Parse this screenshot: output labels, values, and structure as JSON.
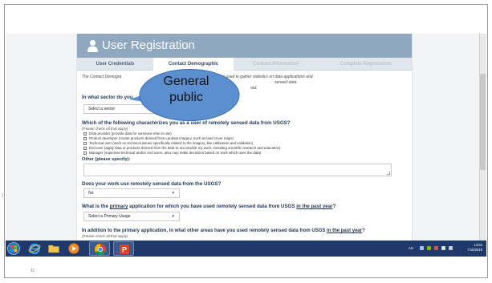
{
  "slide": {
    "number": "11",
    "left_mark": ")"
  },
  "app": {
    "title": "User Registration"
  },
  "tabs": [
    {
      "label": "User Credentials",
      "state": "normal"
    },
    {
      "label": "Contact Demographic",
      "state": "active"
    },
    {
      "label": "Contact Information",
      "state": "disabled"
    },
    {
      "label": "Complete Registration",
      "state": "disabled"
    }
  ],
  "intro": {
    "text": "The Contact Demographic ... data. This information is used to gather statistics on data applications and ... sensed data.",
    "line1_left": "The Contact Demogra",
    "line1_right": "data. This information is used to gather statistics on data applications and",
    "line2_right": "sensed data.",
    "line3_right": "red."
  },
  "callout": {
    "text": "General public"
  },
  "q_sector": {
    "label": "In what sector do you",
    "select_value": "Select a sector"
  },
  "q_characterize": {
    "label": "Which of the following characterizes you as a user of remotely sensed data from USGS?",
    "hint": "(Please check all that apply)",
    "options": [
      "Data provider (provide data for someone else to use)",
      "Product developer (create products derived from Landsat imagery, such as land cover maps)",
      "Technical user (work on technical issues specifically related to the imagery, like calibration and validation)",
      "End user (apply data or products derived from the data to accomplish my work, including scientific research and education)",
      "Manager (supervise technical and/or end users, also may make decisions based on work which uses the data)"
    ],
    "other_label": "Other (please specify):"
  },
  "q_remote": {
    "label": "Does your work use remotely sensed data from the USGS?",
    "select_value": "No"
  },
  "q_primary": {
    "label_pre": "What is the ",
    "label_u": "primary",
    "label_mid": " application for which you have used remotely sensed data from USGS ",
    "label_u2": "in the past year",
    "label_post": "?",
    "select_value": "Select a Primary Usage"
  },
  "q_addition": {
    "label_pre": "In addition to the primary application, in what other areas have you used remotely sensed data from USGS ",
    "label_u": "in the past year",
    "label_post": "?",
    "hint": "(Please check all that apply)"
  },
  "taskbar": {
    "clock_time": "13:54",
    "clock_date": "7/10/2015",
    "tray_text": "AN"
  },
  "colors": {
    "header": "#8fa7bf",
    "taskbar": "#1f3a6a",
    "callout": "#5b8fd0",
    "question_text": "#1f3552"
  }
}
